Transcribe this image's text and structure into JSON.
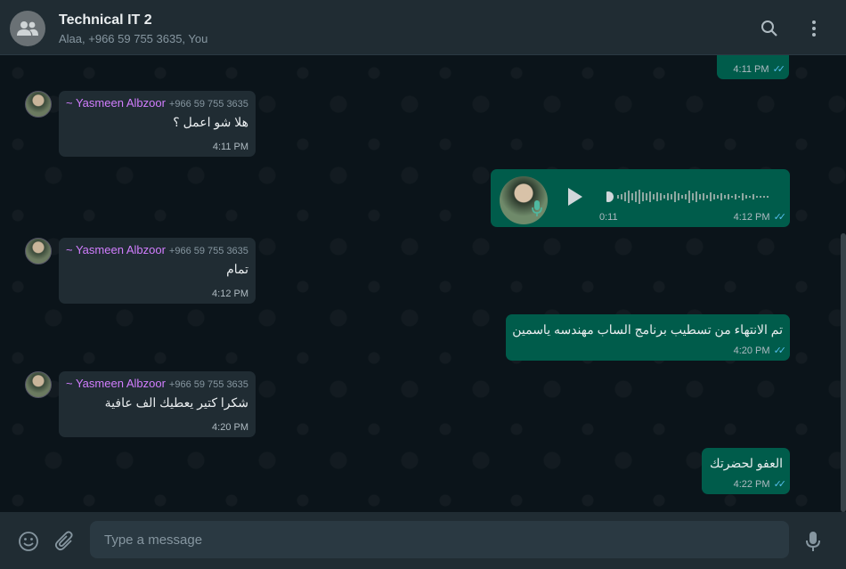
{
  "header": {
    "title": "Technical IT 2",
    "subtitle": "Alaa, +966 59 755 3635, You",
    "search_icon": "search-icon",
    "menu_icon": "more-vertical-icon"
  },
  "messages": {
    "m0": {
      "time": "4:11 PM"
    },
    "m1": {
      "sender": "~ Yasmeen Albzoor",
      "phone": "+966 59 755 3635",
      "text": "هلا شو اعمل ؟",
      "time": "4:11 PM"
    },
    "m2": {
      "duration": "0:11",
      "time": "4:12 PM"
    },
    "m3": {
      "sender": "~ Yasmeen Albzoor",
      "phone": "+966 59 755 3635",
      "text": "تمام",
      "time": "4:12 PM"
    },
    "m4": {
      "text": "تم الانتهاء من تسطيب برنامج الساب مهندسه ياسمين",
      "time": "4:20 PM"
    },
    "m5": {
      "sender": "~ Yasmeen Albzoor",
      "phone": "+966 59 755 3635",
      "text": "شكرا كتير يعطيك الف عافية",
      "time": "4:20 PM"
    },
    "m6": {
      "text": "العفو لحضرتك",
      "time": "4:22 PM"
    }
  },
  "composer": {
    "placeholder": "Type a message",
    "emoji_icon": "emoji-icon",
    "attach_icon": "paperclip-icon",
    "mic_icon": "microphone-icon"
  },
  "colors": {
    "incoming_bubble": "#202c33",
    "outgoing_bubble": "#005c4b",
    "sender_name": "#d27eff",
    "read_ticks": "#53bdeb"
  }
}
